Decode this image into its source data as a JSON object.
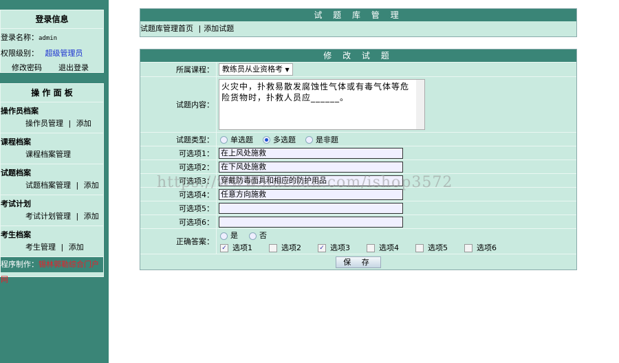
{
  "login": {
    "title": "登录信息",
    "name_label": "登录名称：",
    "name": "admin",
    "level_label": "权限级别：",
    "level": "超级管理员",
    "change_pwd": "修改密码",
    "logout": "退出登录"
  },
  "panel": {
    "title": "操 作 面 板",
    "sections": [
      {
        "title": "操作员档案",
        "links": [
          "操作员管理",
          "添加"
        ]
      },
      {
        "title": "课程档案",
        "links": [
          "课程档案管理"
        ]
      },
      {
        "title": "试题档案",
        "links": [
          "试题档案管理",
          "添加"
        ]
      },
      {
        "title": "考试计划",
        "links": [
          "考试计划管理",
          "添加"
        ]
      },
      {
        "title": "考生档案",
        "links": [
          "考生管理",
          "添加"
        ]
      }
    ],
    "maker_label": "程序制作：",
    "maker": "锡林郭勒综合门户网"
  },
  "top": {
    "title": "试 题 库 管 理",
    "crumb1": "试题库管理首页",
    "sep": "|",
    "crumb2": "添加试题"
  },
  "form": {
    "title": "修 改 试 题",
    "course_label": "所属课程：",
    "course": "教练员从业资格考",
    "content_label": "试题内容：",
    "content": "火灾中，扑救易散发腐蚀性气体或有毒气体等危险货物时，扑救人员应______。",
    "type_label": "试题类型：",
    "types": [
      "单选题",
      "多选题",
      "是非题"
    ],
    "type_selected": 1,
    "options": [
      {
        "label": "可选项1：",
        "value": "在上风处施救"
      },
      {
        "label": "可选项2：",
        "value": "在下风处施救"
      },
      {
        "label": "可选项3：",
        "value": "穿戴防毒面具和相应的防护用品"
      },
      {
        "label": "可选项4：",
        "value": "任意方向施救"
      },
      {
        "label": "可选项5：",
        "value": ""
      },
      {
        "label": "可选项6：",
        "value": ""
      }
    ],
    "answer_label": "正确答案：",
    "yes": "是",
    "no": "否",
    "answer_checks": [
      {
        "label": "选项1",
        "checked": true
      },
      {
        "label": "选项2",
        "checked": false
      },
      {
        "label": "选项3",
        "checked": true
      },
      {
        "label": "选项4",
        "checked": false
      },
      {
        "label": "选项5",
        "checked": false
      },
      {
        "label": "选项6",
        "checked": false
      }
    ],
    "save": "保 存"
  },
  "watermark": "https://www.huzhan.com/ishop3572"
}
